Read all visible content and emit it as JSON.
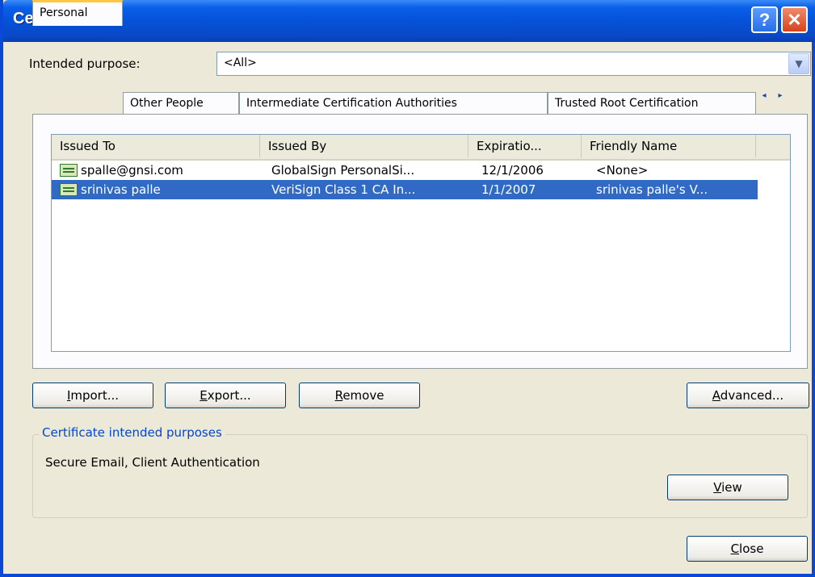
{
  "window": {
    "title": "Certificates",
    "help_button": "?",
    "close_button": "✕"
  },
  "intended_purpose": {
    "label": "Intended purpose:",
    "value": "<All>"
  },
  "tabs": [
    {
      "label": "Personal",
      "active": true
    },
    {
      "label": "Other People",
      "active": false
    },
    {
      "label": "Intermediate Certification Authorities",
      "active": false
    },
    {
      "label": "Trusted Root Certification",
      "active": false
    }
  ],
  "tab_scroll": {
    "left": "◂",
    "right": "▸"
  },
  "table": {
    "columns": [
      "Issued To",
      "Issued By",
      "Expiratio...",
      "Friendly Name"
    ],
    "rows": [
      {
        "issued_to": "spalle@gnsi.com",
        "issued_by": "GlobalSign PersonalSi...",
        "expiration": "12/1/2006",
        "friendly_name": "<None>",
        "selected": false
      },
      {
        "issued_to": "srinivas palle",
        "issued_by": "VeriSign Class 1 CA In...",
        "expiration": "1/1/2007",
        "friendly_name": "srinivas palle's V...",
        "selected": true
      }
    ]
  },
  "buttons": {
    "import": {
      "mnemonic": "I",
      "rest": "mport..."
    },
    "export": {
      "mnemonic": "E",
      "rest": "xport..."
    },
    "remove": {
      "mnemonic": "R",
      "rest": "emove"
    },
    "advanced": {
      "mnemonic": "A",
      "rest": "dvanced..."
    },
    "view": {
      "mnemonic": "V",
      "rest": "iew"
    },
    "close": {
      "mnemonic": "C",
      "rest": "lose"
    }
  },
  "intended_purposes_group": {
    "legend": "Certificate intended purposes",
    "text": "Secure Email, Client Authentication"
  },
  "colors": {
    "title_bar": "#0552d8",
    "selection": "#316ac5",
    "dialog_bg": "#ece9d8",
    "group_legend": "#0046d5"
  }
}
